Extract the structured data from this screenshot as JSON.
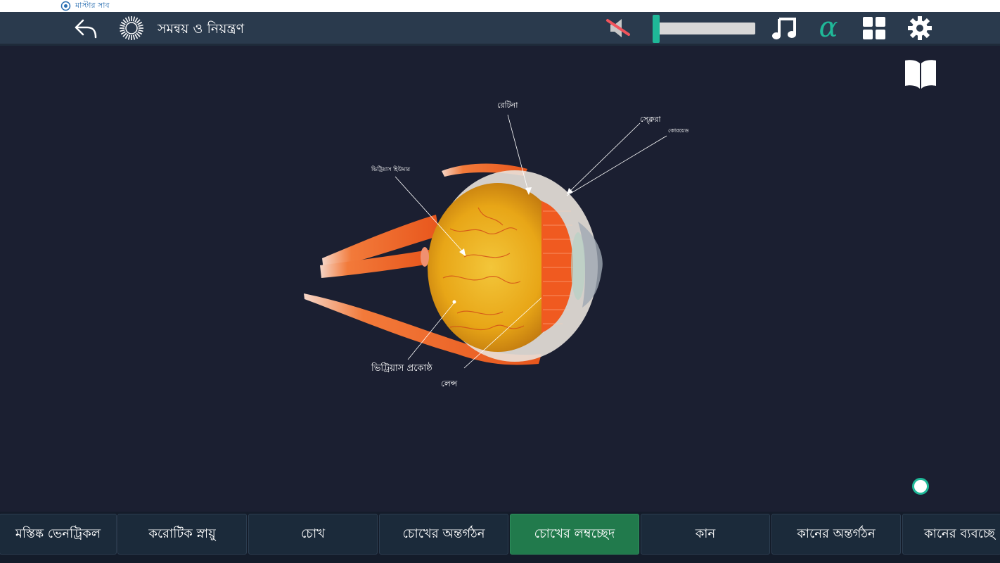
{
  "window": {
    "title": "মাস্টার সাব"
  },
  "header": {
    "title": "সমন্বয় ও নিয়ন্ত্রণ"
  },
  "volume": {
    "level": 0.0
  },
  "header_icons": {
    "alpha": "α",
    "back": "undo-arrow-icon",
    "logo": "sun-icon",
    "mute": "speaker-muted-icon",
    "music": "music-note-icon",
    "grid": "grid-icon",
    "settings": "gear-icon",
    "book": "open-book-icon"
  },
  "labels": {
    "retina": "রেটিনা",
    "sclera": "স্ক্লেরা",
    "choroid": "কোরয়েড",
    "vitreous_humor": "ভিট্রিয়াস হিউমার",
    "vitreous_chamber": "ভিট্রিয়াস প্রকোষ্ঠ",
    "lens": "লেন্স"
  },
  "tabs": [
    {
      "label": "মস্তিষ্ক ভেনট্রিকল"
    },
    {
      "label": "করোটিক  স্নায়ু"
    },
    {
      "label": "চোখ"
    },
    {
      "label": "চোখের অন্তর্গঠন"
    },
    {
      "label": "চোখের লম্বচ্ছেদ",
      "active": true
    },
    {
      "label": "কান"
    },
    {
      "label": "কানের অন্তর্গঠন"
    },
    {
      "label": "কানের ব্যবচ্ছে"
    }
  ],
  "colors": {
    "accent": "#1fb898",
    "active_tab": "#217a4c",
    "background": "#1b1f31",
    "topbar": "#2a3a4d",
    "muscle": "#f06a2a",
    "vitreous": "#e8a617"
  }
}
